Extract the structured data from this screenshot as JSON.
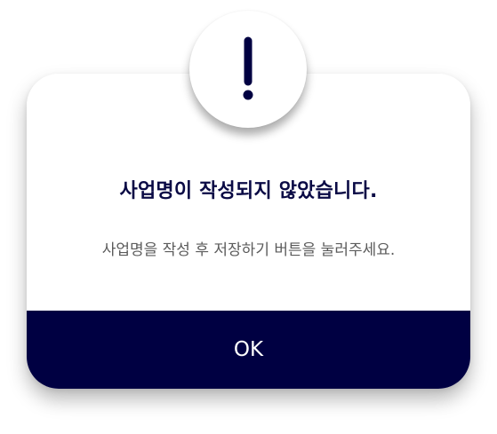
{
  "dialog": {
    "title": "사업명이 작성되지 않았습니다.",
    "message": "사업명을 작성 후 저장하기 버튼을 눌러주세요.",
    "ok_label": "OK",
    "icon": "exclamation-icon"
  },
  "colors": {
    "primary": "#000042",
    "title": "#0a0a45",
    "message": "#5b5b5b",
    "background": "#ffffff"
  }
}
